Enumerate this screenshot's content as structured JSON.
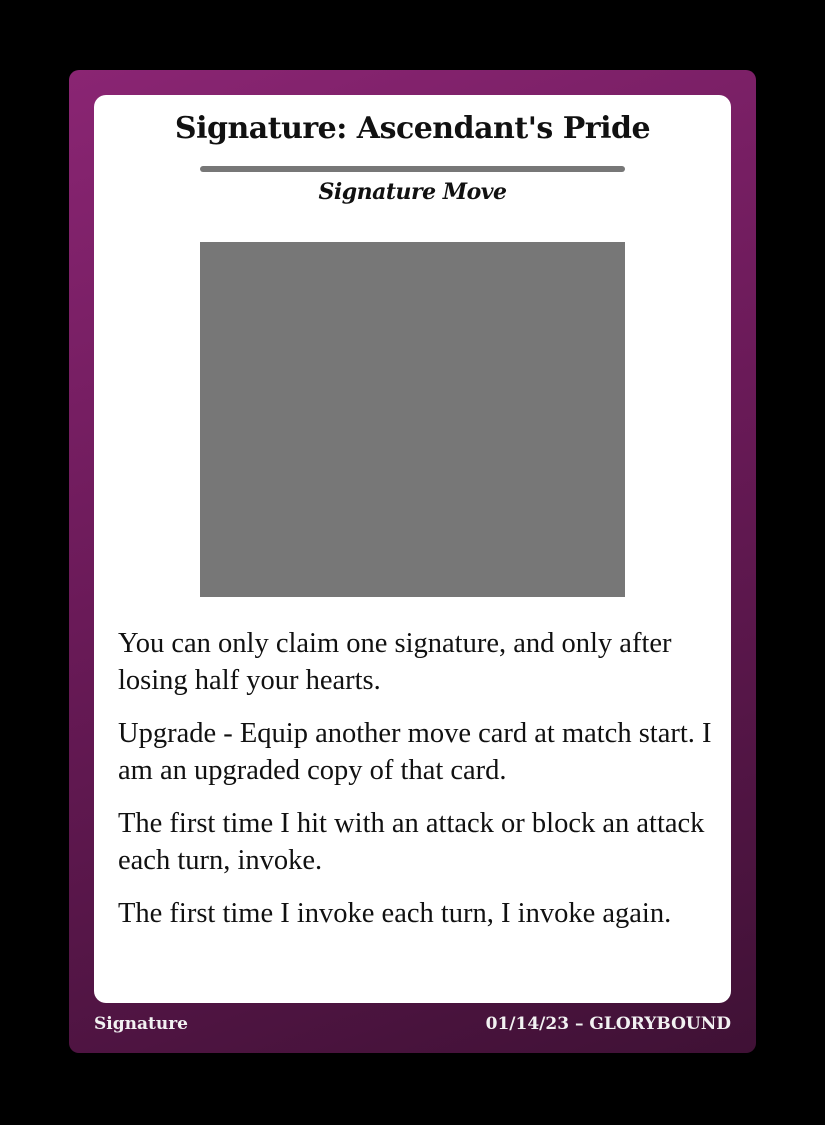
{
  "card": {
    "title": "Signature: Ascendant's Pride",
    "type_line": "Signature Move",
    "art": "art-placeholder",
    "rules": [
      "You can only claim one signature, and only after losing half your hearts.",
      "Upgrade - Equip another move card at match start. I am an upgraded copy of that card.",
      "The first time I hit with an attack or block an attack each turn, invoke.",
      "The first time I invoke each turn, I invoke again."
    ],
    "footer": {
      "category": "Signature",
      "date_and_set": "01/14/23 – GLORYBOUND"
    }
  },
  "colors": {
    "frame_top": "#8a2573",
    "frame_bottom": "#3f1135",
    "art_placeholder": "#777777",
    "rule_line": "#777777",
    "background": "#000000"
  }
}
